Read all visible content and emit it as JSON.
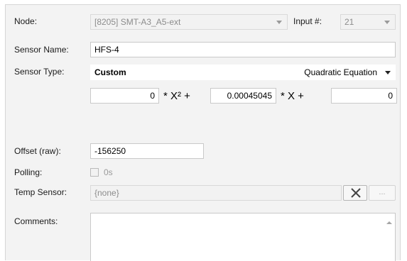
{
  "node": {
    "label": "Node:",
    "value": "[8205] SMT-A3_A5-ext"
  },
  "input": {
    "label": "Input #:",
    "value": "21"
  },
  "sensor_name": {
    "label": "Sensor Name:",
    "value": "HFS-4"
  },
  "sensor_type": {
    "label": "Sensor Type:",
    "value": "Custom",
    "equation": "Quadratic Equation"
  },
  "coefficients": {
    "a": "0",
    "x2_label": "* X² +",
    "b": "0.00045045",
    "x_label": "* X +",
    "c": "0"
  },
  "offset": {
    "label": "Offset (raw):",
    "value": "-156250"
  },
  "polling": {
    "label": "Polling:",
    "value": "0s",
    "checked": false
  },
  "temp_sensor": {
    "label": "Temp Sensor:",
    "value": "{none}",
    "clear_icon": "x-icon",
    "browse_label": "..."
  },
  "comments": {
    "label": "Comments:",
    "value": ""
  },
  "colors": {
    "panel_bg": "#f3f3f3",
    "border": "#c9c9c9",
    "disabled_text": "#8c8c8c"
  }
}
